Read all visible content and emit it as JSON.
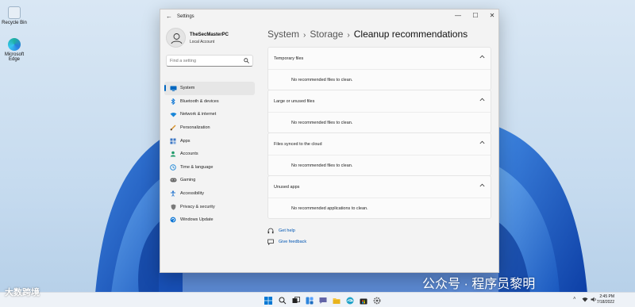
{
  "desktop": {
    "icons": [
      {
        "label": "Recycle Bin",
        "icon": "recycle-bin-icon"
      },
      {
        "label": "Microsoft Edge",
        "icon": "edge-icon"
      }
    ]
  },
  "window": {
    "title": "Settings",
    "back_glyph": "←",
    "controls": {
      "minimize": "—",
      "maximize": "☐",
      "close": "✕"
    }
  },
  "profile": {
    "name": "TheSecMasterPC",
    "account_type": "Local Account"
  },
  "search": {
    "placeholder": "Find a setting",
    "icon": "search-icon"
  },
  "sidebar": {
    "items": [
      {
        "label": "System",
        "icon": "monitor-icon",
        "color": "#0067c0",
        "active": true
      },
      {
        "label": "Bluetooth & devices",
        "icon": "bluetooth-icon",
        "color": "#0a74d4"
      },
      {
        "label": "Network & internet",
        "icon": "wifi-icon",
        "color": "#1a86d8"
      },
      {
        "label": "Personalization",
        "icon": "brush-icon",
        "color": "#d8912a"
      },
      {
        "label": "Apps",
        "icon": "apps-icon",
        "color": "#3b76c3"
      },
      {
        "label": "Accounts",
        "icon": "person-icon",
        "color": "#1f9a6a"
      },
      {
        "label": "Time & language",
        "icon": "globe-clock-icon",
        "color": "#1a86d8"
      },
      {
        "label": "Gaming",
        "icon": "gamepad-icon",
        "color": "#666666"
      },
      {
        "label": "Accessibility",
        "icon": "accessibility-icon",
        "color": "#2e7bd1"
      },
      {
        "label": "Privacy & security",
        "icon": "shield-icon",
        "color": "#7a7a7a"
      },
      {
        "label": "Windows Update",
        "icon": "update-icon",
        "color": "#0a74d4"
      }
    ]
  },
  "breadcrumb": {
    "items": [
      "System",
      "Storage"
    ],
    "separator": "›",
    "current": "Cleanup recommendations"
  },
  "sections": [
    {
      "title": "Temporary files",
      "message": "No recommended files to clean."
    },
    {
      "title": "Large or unused files",
      "message": "No recommended files to clean."
    },
    {
      "title": "Files synced to the cloud",
      "message": "No recommended files to clean."
    },
    {
      "title": "Unused apps",
      "message": "No recommended applications to clean."
    }
  ],
  "links": [
    {
      "label": "Get help",
      "icon": "help-icon"
    },
    {
      "label": "Give feedback",
      "icon": "feedback-icon"
    }
  ],
  "taskbar": {
    "clock_time": "2:45 PM",
    "clock_date": "7/18/2022",
    "pinned": [
      "windows-start-icon",
      "search-icon",
      "task-view-icon",
      "widgets-icon",
      "teams-chat-icon",
      "file-explorer-icon",
      "edge-icon",
      "microsoft-store-icon",
      "settings-icon"
    ]
  },
  "watermarks": {
    "left": "大数跨境",
    "right": "公众号 · 程序员黎明"
  },
  "colors": {
    "accent": "#0067c0",
    "link": "#0056b3"
  }
}
